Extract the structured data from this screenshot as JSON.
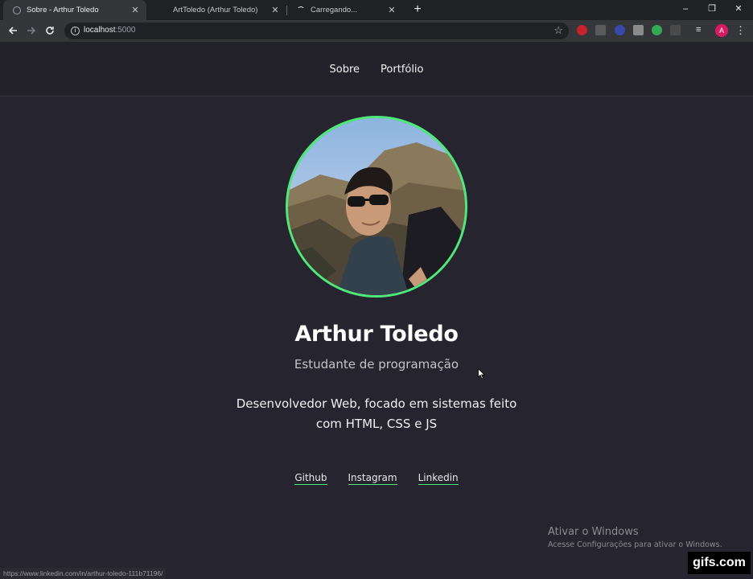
{
  "browser": {
    "tabs": [
      {
        "title": "Sobre - Arthur Toledo",
        "active": true,
        "favicon": "globe-icon"
      },
      {
        "title": "ArtToledo (Arthur Toledo)",
        "active": false,
        "favicon": "none"
      },
      {
        "title": "Carregando...",
        "active": false,
        "favicon": "loading-spinner-icon"
      }
    ],
    "address": {
      "host": "localhost",
      "port": ":5000"
    },
    "window_controls": {
      "minimize": "–",
      "restore": "❐",
      "close": "✕"
    },
    "profile_initial": "A",
    "status_url": "https://www.linkedin.com/in/arthur-toledo-111b71196/"
  },
  "site": {
    "nav": [
      {
        "label": "Sobre"
      },
      {
        "label": "Portfólio"
      }
    ],
    "profile": {
      "name": "Arthur Toledo",
      "role": "Estudante de programação",
      "bio": "Desenvolvedor Web, focado em sistemas feito com HTML, CSS e JS"
    },
    "social_links": [
      {
        "label": "Github"
      },
      {
        "label": "Instagram"
      },
      {
        "label": "Linkedin"
      }
    ],
    "accent_color": "#4dea7a"
  },
  "overlay": {
    "activation_title": "Ativar o Windows",
    "activation_subtitle": "Acesse Configurações para ativar o Windows.",
    "gif_badge": "gifs.com"
  }
}
